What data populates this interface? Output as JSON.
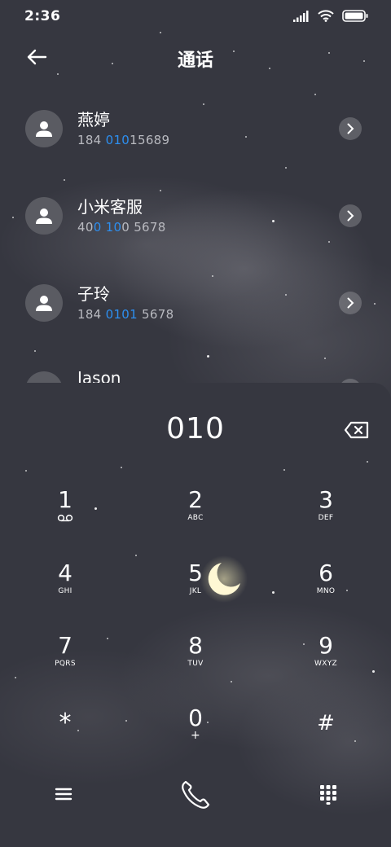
{
  "status_bar": {
    "time": "2:36",
    "icons": [
      "signal-icon",
      "wifi-icon",
      "battery-icon"
    ]
  },
  "header": {
    "title": "通话",
    "back_icon": "arrow-left-icon"
  },
  "contacts": [
    {
      "name": "燕婷",
      "number_pre": "184 ",
      "number_hl": "010",
      "number_post": "15689"
    },
    {
      "name": "小米客服",
      "number_pre": "40",
      "number_hl": "0 10",
      "number_post": "0 5678"
    },
    {
      "name": "子玲",
      "number_pre": "184 ",
      "number_hl": "0101",
      "number_post": " 5678"
    },
    {
      "name": "Jason",
      "number_pre": "",
      "number_hl": "",
      "number_post": ""
    }
  ],
  "dialer": {
    "input": "010",
    "keys": [
      {
        "digit": "1",
        "letters": ""
      },
      {
        "digit": "2",
        "letters": "ABC"
      },
      {
        "digit": "3",
        "letters": "DEF"
      },
      {
        "digit": "4",
        "letters": "GHI"
      },
      {
        "digit": "5",
        "letters": "JKL"
      },
      {
        "digit": "6",
        "letters": "MNO"
      },
      {
        "digit": "7",
        "letters": "PQRS"
      },
      {
        "digit": "8",
        "letters": "TUV"
      },
      {
        "digit": "9",
        "letters": "WXYZ"
      },
      {
        "digit": "*",
        "letters": ""
      },
      {
        "digit": "0",
        "letters": "+"
      },
      {
        "digit": "#",
        "letters": ""
      }
    ]
  },
  "colors": {
    "background": "#363740",
    "highlight": "#2d8ff0",
    "moon": "#fff6c8"
  }
}
